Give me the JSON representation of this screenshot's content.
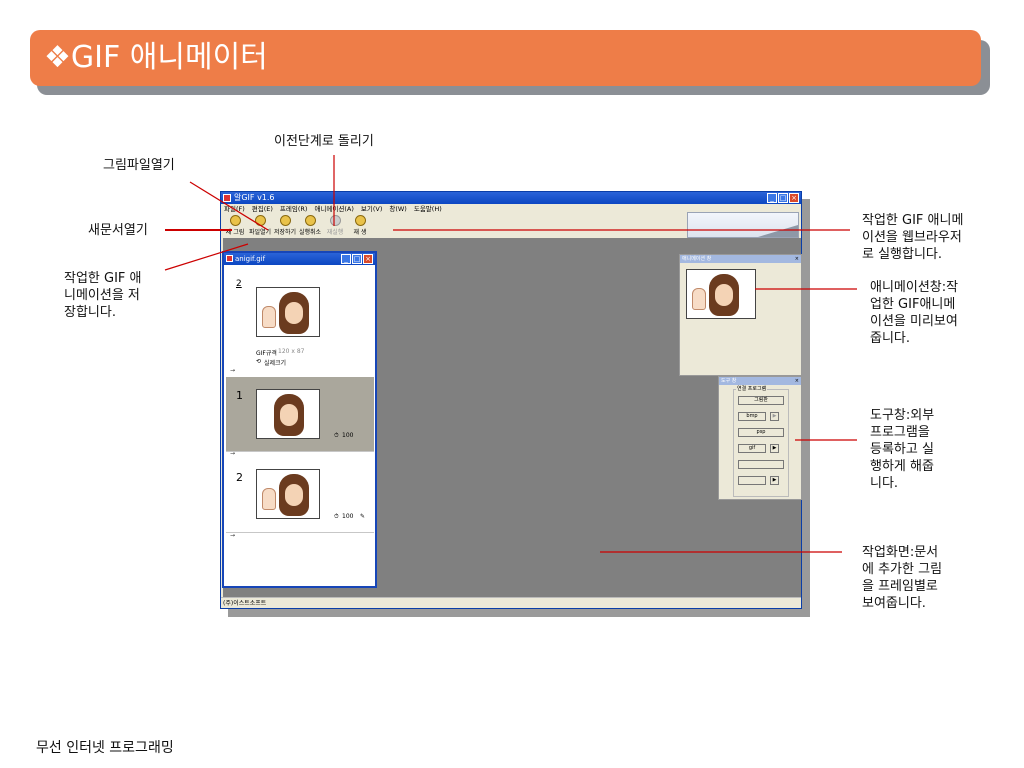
{
  "slide": {
    "title": "❖GIF 애니메이터",
    "footer": "무선 인터넷 프로그래밍"
  },
  "callouts": {
    "open_image": "그림파일열기",
    "undo": "이전단계로 돌리기",
    "new_doc": "새문서열기",
    "save": "작업한 GIF 애\n니메이션을 저\n장합니다.",
    "run_browser": "작업한 GIF 애니메\n이션을 웹브라우저\n로 실행합니다.",
    "preview_window": "애니메이션창:작\n업한 GIF애니메\n이션을 미리보여\n줍니다.",
    "tool_window": "도구창:외부\n프로그램을\n등록하고 실\n행하게 해줍\n니다.",
    "workspace": "작업화면:문서\n에 추가한 그림\n을 프레임별로\n보여줍니다."
  },
  "app": {
    "title": "알GIF v1.6",
    "menu": [
      "파일(F)",
      "편집(E)",
      "프레임(R)",
      "애니메이션(A)",
      "보기(V)",
      "창(W)",
      "도움말(H)"
    ],
    "toolbar": [
      "새 그림",
      "파일열기",
      "저장하기",
      "실행취소",
      "재실행",
      "재 생"
    ],
    "status": "(주)이스트소프트",
    "document": {
      "title": "anigif.gif",
      "gif_spec_label": "GIF규격",
      "gif_spec_value": "120 x 87",
      "actual_size": "실제크기",
      "frame0_number": "2",
      "frame1_number": "1",
      "frame2_number": "2",
      "frame1_delay": "100",
      "frame2_delay": "100"
    },
    "preview": {
      "title": "애니메이션 창"
    },
    "tools": {
      "title": "도구 창",
      "group_label": "연결 프로그램",
      "paint": "그림판",
      "bmp": "bmp",
      "psp": "psp",
      "gif": "gif"
    }
  },
  "colors": {
    "title_bar": "#ee7d48",
    "callout_line": "#cc0000",
    "window_blue": "#0c47c2",
    "workspace": "#808080"
  }
}
